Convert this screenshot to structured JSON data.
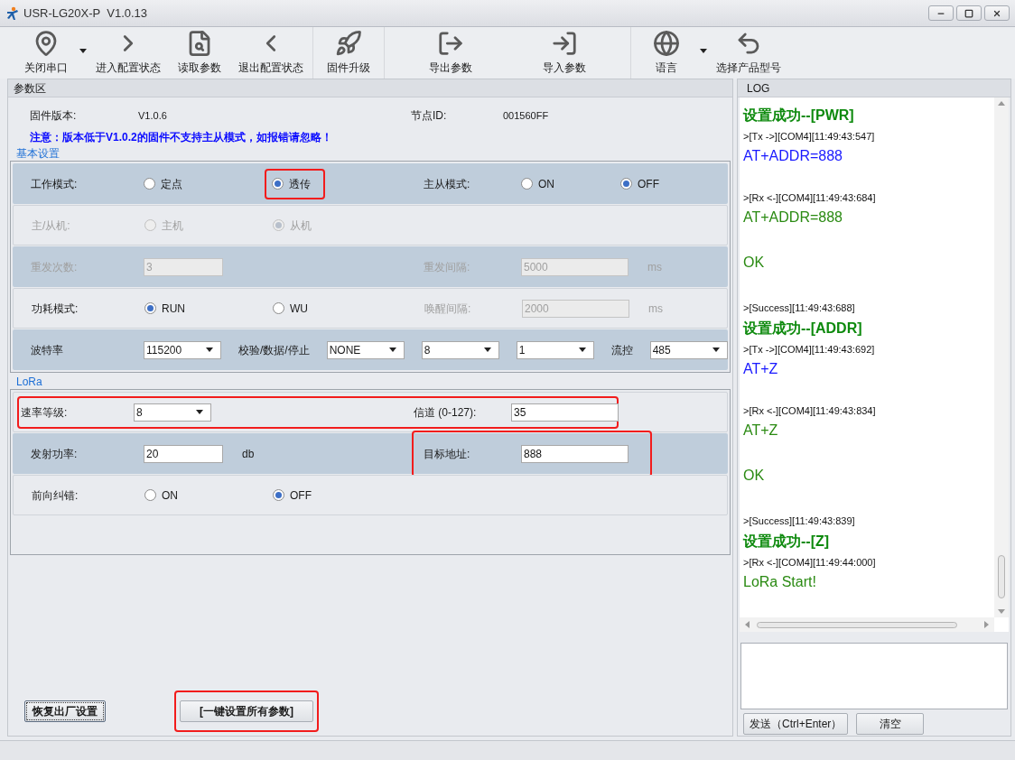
{
  "window": {
    "title": "USR-LG20X-P  V1.0.13"
  },
  "toolbar": {
    "groups": [
      [
        {
          "label": "关闭串口",
          "dropdown": true
        },
        {
          "label": "进入配置状态",
          "dropdown": false
        },
        {
          "label": "读取参数",
          "dropdown": false
        },
        {
          "label": "退出配置状态",
          "dropdown": false
        }
      ],
      [
        {
          "label": "固件升级",
          "dropdown": false
        }
      ],
      [
        {
          "label": "导出参数",
          "dropdown": false
        },
        {
          "label": "导入参数",
          "dropdown": false
        }
      ],
      [
        {
          "label": "语言",
          "dropdown": true
        },
        {
          "label": "选择产品型号",
          "dropdown": false
        }
      ]
    ]
  },
  "params": {
    "title": "参数区",
    "firmware_label": "固件版本:",
    "firmware_value": "V1.0.6",
    "node_label": "节点ID:",
    "node_value": "001560FF",
    "notice": "注意：版本低于V1.0.2的固件不支持主从模式，如报错请忽略！",
    "groups": [
      {
        "title": "基本设置",
        "rows": [
          {
            "shaded": true,
            "highlighted": false,
            "left": {
              "highlighted": false,
              "items": [
                {
                  "kind": "label",
                  "text": "工作模式:",
                  "disabled": false,
                  "highlighted": false
                },
                {
                  "kind": "radio",
                  "text": "定点",
                  "selected": false,
                  "disabled": false,
                  "highlighted": false
                },
                {
                  "kind": "radio",
                  "text": "透传",
                  "selected": true,
                  "disabled": false,
                  "highlighted": true
                }
              ]
            },
            "right": {
              "highlighted": false,
              "items": [
                {
                  "kind": "label",
                  "text": "主从模式:",
                  "disabled": false,
                  "highlighted": false
                },
                {
                  "kind": "radio",
                  "text": "ON",
                  "selected": false,
                  "disabled": false,
                  "highlighted": false
                },
                {
                  "kind": "radio",
                  "text": "OFF",
                  "selected": true,
                  "disabled": false,
                  "highlighted": false
                }
              ]
            }
          },
          {
            "shaded": false,
            "highlighted": false,
            "left": {
              "highlighted": false,
              "items": [
                {
                  "kind": "label",
                  "text": "主/从机:",
                  "disabled": true,
                  "highlighted": false
                },
                {
                  "kind": "radio",
                  "text": "主机",
                  "selected": false,
                  "disabled": true,
                  "highlighted": false
                },
                {
                  "kind": "radio",
                  "text": "从机",
                  "selected": true,
                  "disabled": true,
                  "highlighted": false
                }
              ]
            }
          },
          {
            "shaded": true,
            "highlighted": false,
            "left": {
              "highlighted": false,
              "items": [
                {
                  "kind": "label",
                  "text": "重发次数:",
                  "disabled": true,
                  "highlighted": false
                },
                {
                  "kind": "input",
                  "text": "3",
                  "disabled": true,
                  "highlighted": false
                }
              ]
            },
            "right": {
              "highlighted": false,
              "items": [
                {
                  "kind": "label",
                  "text": "重发间隔:",
                  "disabled": true,
                  "highlighted": false
                },
                {
                  "kind": "input",
                  "text": "5000",
                  "disabled": true,
                  "highlighted": false
                },
                {
                  "kind": "unit",
                  "text": "ms",
                  "disabled": true,
                  "highlighted": false
                }
              ]
            }
          },
          {
            "shaded": false,
            "highlighted": false,
            "left": {
              "highlighted": false,
              "items": [
                {
                  "kind": "label",
                  "text": "功耗模式:",
                  "disabled": false,
                  "highlighted": false
                },
                {
                  "kind": "radio",
                  "text": "RUN",
                  "selected": true,
                  "disabled": false,
                  "highlighted": false
                },
                {
                  "kind": "radio",
                  "text": "WU",
                  "selected": false,
                  "disabled": false,
                  "highlighted": false
                }
              ]
            },
            "right": {
              "highlighted": false,
              "items": [
                {
                  "kind": "label",
                  "text": "唤醒间隔:",
                  "disabled": true,
                  "highlighted": false
                },
                {
                  "kind": "input",
                  "text": "2000",
                  "disabled": true,
                  "highlighted": false
                },
                {
                  "kind": "unit",
                  "text": "ms",
                  "disabled": true,
                  "highlighted": false
                }
              ]
            }
          },
          {
            "shaded": true,
            "highlighted": false,
            "left": {
              "highlighted": false,
              "items": [
                {
                  "kind": "label",
                  "text": "波特率",
                  "disabled": false,
                  "highlighted": false
                },
                {
                  "kind": "select",
                  "text": "115200",
                  "disabled": false,
                  "highlighted": false
                },
                {
                  "kind": "label",
                  "text": "校验/数据/停止",
                  "disabled": false,
                  "highlighted": false
                },
                {
                  "kind": "select",
                  "text": "NONE",
                  "disabled": false,
                  "highlighted": false
                },
                {
                  "kind": "select",
                  "text": "8",
                  "disabled": false,
                  "highlighted": false
                },
                {
                  "kind": "select",
                  "text": "1",
                  "disabled": false,
                  "highlighted": false
                },
                {
                  "kind": "label",
                  "text": "流控",
                  "disabled": false,
                  "highlighted": false
                },
                {
                  "kind": "select",
                  "text": "485",
                  "disabled": false,
                  "highlighted": false
                }
              ]
            }
          }
        ]
      },
      {
        "title": "LoRa",
        "rows": [
          {
            "shaded": false,
            "highlighted": true,
            "left": {
              "highlighted": false,
              "items": [
                {
                  "kind": "label",
                  "text": "速率等级:",
                  "disabled": false,
                  "highlighted": false
                },
                {
                  "kind": "select",
                  "text": "8",
                  "disabled": false,
                  "highlighted": false
                }
              ]
            },
            "right": {
              "highlighted": false,
              "items": [
                {
                  "kind": "label",
                  "text": "信道 (0-127):",
                  "disabled": false,
                  "highlighted": false
                },
                {
                  "kind": "input",
                  "text": "35",
                  "disabled": false,
                  "highlighted": false
                }
              ]
            }
          },
          {
            "shaded": true,
            "highlighted": false,
            "left": {
              "highlighted": false,
              "items": [
                {
                  "kind": "label",
                  "text": "发射功率:",
                  "disabled": false,
                  "highlighted": false
                },
                {
                  "kind": "input",
                  "text": "20",
                  "disabled": false,
                  "highlighted": false
                },
                {
                  "kind": "unit",
                  "text": "db",
                  "disabled": false,
                  "highlighted": false
                }
              ]
            },
            "right": {
              "highlighted": true,
              "items": [
                {
                  "kind": "label",
                  "text": "目标地址:",
                  "disabled": false,
                  "highlighted": false
                },
                {
                  "kind": "input",
                  "text": "888",
                  "disabled": false,
                  "highlighted": false
                }
              ]
            }
          },
          {
            "shaded": false,
            "highlighted": false,
            "left": {
              "highlighted": false,
              "items": [
                {
                  "kind": "label",
                  "text": "前向纠错:",
                  "disabled": false,
                  "highlighted": false
                },
                {
                  "kind": "radio",
                  "text": "ON",
                  "selected": false,
                  "disabled": false,
                  "highlighted": false
                },
                {
                  "kind": "radio",
                  "text": "OFF",
                  "selected": true,
                  "disabled": false,
                  "highlighted": false
                }
              ]
            }
          }
        ]
      }
    ],
    "buttons": [
      {
        "label": "恢复出厂设置",
        "focused": true,
        "highlighted": false
      },
      {
        "label": "[一键设置所有参数]",
        "focused": false,
        "highlighted": true
      }
    ]
  },
  "log": {
    "title": "LOG",
    "entries": [
      {
        "kind": "success",
        "text": "设置成功--[PWR]"
      },
      {
        "kind": "meta",
        "text": ">[Tx ->][COM4][11:49:43:547]"
      },
      {
        "kind": "tx",
        "text": "AT+ADDR=888"
      },
      {
        "kind": "meta",
        "text": ">[Rx <-][COM4][11:49:43:684]"
      },
      {
        "kind": "rx",
        "text": "AT+ADDR=888"
      },
      {
        "kind": "rx",
        "text": "OK"
      },
      {
        "kind": "meta",
        "text": ">[Success][11:49:43:688]"
      },
      {
        "kind": "success",
        "text": "设置成功--[ADDR]"
      },
      {
        "kind": "meta",
        "text": ">[Tx ->][COM4][11:49:43:692]"
      },
      {
        "kind": "tx",
        "text": "AT+Z"
      },
      {
        "kind": "meta",
        "text": ">[Rx <-][COM4][11:49:43:834]"
      },
      {
        "kind": "rx",
        "text": "AT+Z"
      },
      {
        "kind": "rx",
        "text": "OK"
      },
      {
        "kind": "meta",
        "text": ">[Success][11:49:43:839]"
      },
      {
        "kind": "success",
        "text": "设置成功--[Z]"
      },
      {
        "kind": "meta",
        "text": ">[Rx <-][COM4][11:49:44:000]"
      },
      {
        "kind": "rx_last",
        "text": "LoRa Start!"
      }
    ],
    "buttons": [
      "发送（Ctrl+Enter）",
      "清空"
    ]
  }
}
